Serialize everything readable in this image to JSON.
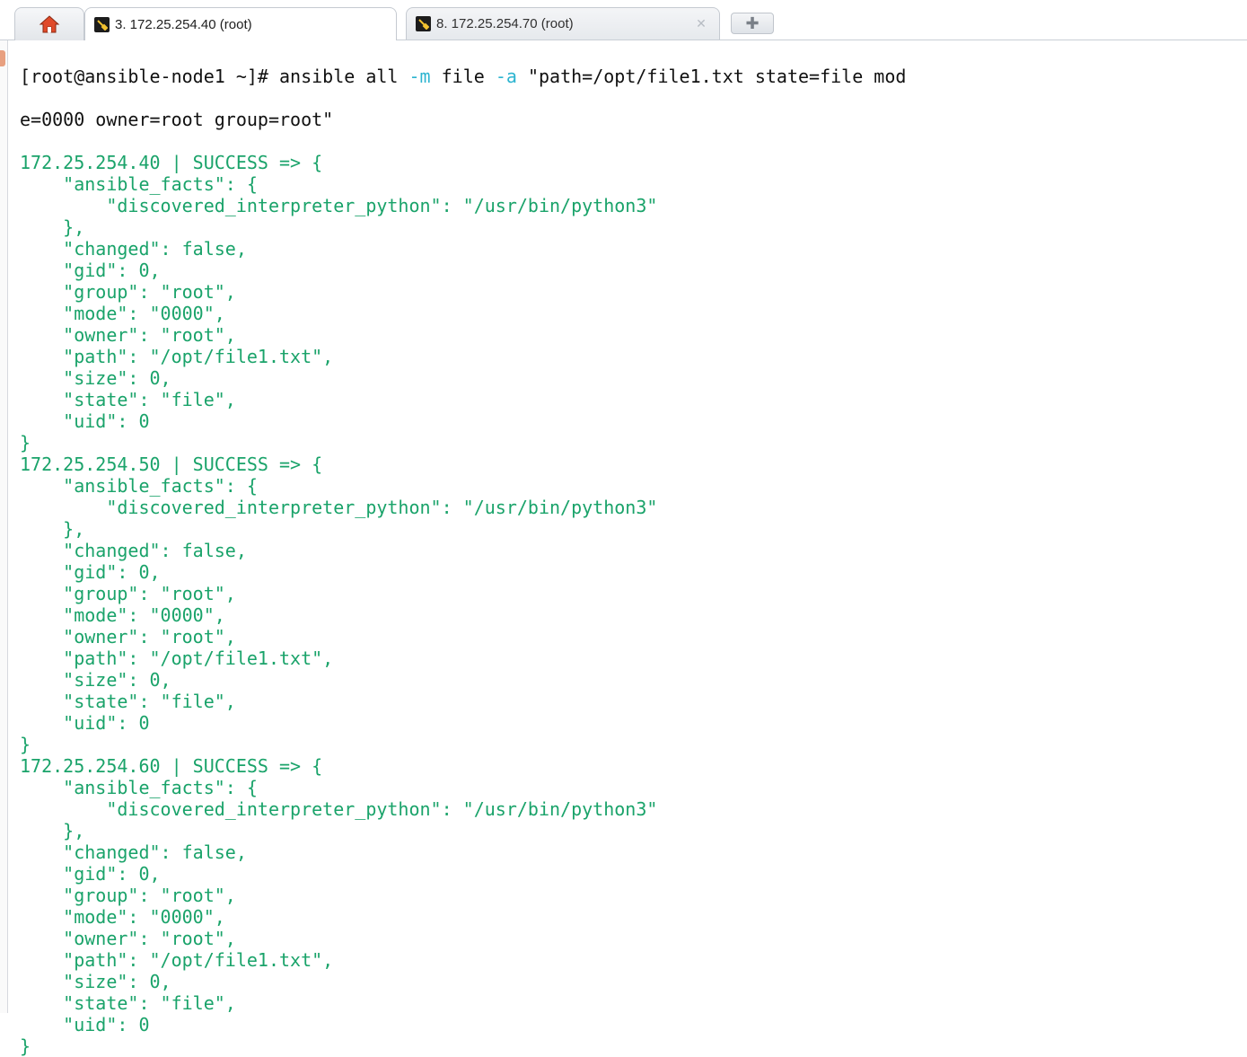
{
  "tabs": [
    {
      "label": "3. 172.25.254.40 (root)",
      "active": true,
      "icon": "terminal-key-icon"
    },
    {
      "label": "8. 172.25.254.70 (root)",
      "active": false,
      "icon": "terminal-key-icon"
    }
  ],
  "colors": {
    "text": "#111111",
    "success_output": "#1aa36a",
    "option_flag": "#2cb4d0",
    "background": "#ffffff"
  },
  "terminal": {
    "prompt": "[root@ansible-node1 ~]# ",
    "cmd_ansible": "ansible all ",
    "flag_m": "-m",
    "cmd_file": " file ",
    "flag_a": "-a",
    "cmd_args": " \"path=/opt/file1.txt state=file mod",
    "cmd_wrap": "e=0000 owner=root group=root\"",
    "results": [
      {
        "header": "172.25.254.40 | SUCCESS => {",
        "lines": [
          "    \"ansible_facts\": {",
          "        \"discovered_interpreter_python\": \"/usr/bin/python3\"",
          "    },",
          "    \"changed\": false,",
          "    \"gid\": 0,",
          "    \"group\": \"root\",",
          "    \"mode\": \"0000\",",
          "    \"owner\": \"root\",",
          "    \"path\": \"/opt/file1.txt\",",
          "    \"size\": 0,",
          "    \"state\": \"file\",",
          "    \"uid\": 0"
        ],
        "footer": "}"
      },
      {
        "header": "172.25.254.50 | SUCCESS => {",
        "lines": [
          "    \"ansible_facts\": {",
          "        \"discovered_interpreter_python\": \"/usr/bin/python3\"",
          "    },",
          "    \"changed\": false,",
          "    \"gid\": 0,",
          "    \"group\": \"root\",",
          "    \"mode\": \"0000\",",
          "    \"owner\": \"root\",",
          "    \"path\": \"/opt/file1.txt\",",
          "    \"size\": 0,",
          "    \"state\": \"file\",",
          "    \"uid\": 0"
        ],
        "footer": "}"
      },
      {
        "header": "172.25.254.60 | SUCCESS => {",
        "lines": [
          "    \"ansible_facts\": {",
          "        \"discovered_interpreter_python\": \"/usr/bin/python3\"",
          "    },",
          "    \"changed\": false,",
          "    \"gid\": 0,",
          "    \"group\": \"root\",",
          "    \"mode\": \"0000\",",
          "    \"owner\": \"root\",",
          "    \"path\": \"/opt/file1.txt\",",
          "    \"size\": 0,",
          "    \"state\": \"file\",",
          "    \"uid\": 0"
        ],
        "footer": "}"
      }
    ]
  }
}
